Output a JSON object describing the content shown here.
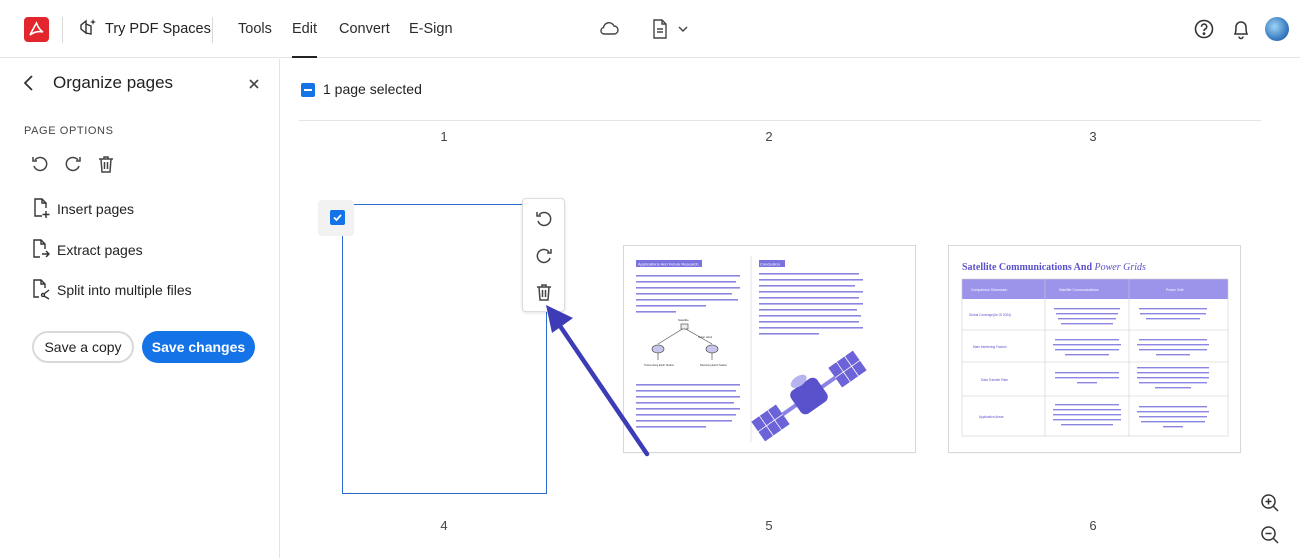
{
  "topbar": {
    "spaces_label": "Try PDF Spaces",
    "nav": [
      {
        "label": "Tools",
        "active": false
      },
      {
        "label": "Edit",
        "active": true
      },
      {
        "label": "Convert",
        "active": false
      },
      {
        "label": "E-Sign",
        "active": false
      }
    ],
    "icons": [
      "acrobat-logo-icon",
      "cloud-icon",
      "document-icon",
      "chevron-down-icon",
      "help-icon",
      "bell-icon",
      "avatar"
    ]
  },
  "sidebar": {
    "title": "Organize pages",
    "options_header": "PAGE OPTIONS",
    "items": [
      {
        "label": "Insert pages"
      },
      {
        "label": "Extract pages"
      },
      {
        "label": "Split into multiple files"
      }
    ],
    "save_copy_label": "Save a copy",
    "save_changes_label": "Save changes"
  },
  "main": {
    "selection_text": "1 page selected",
    "page_numbers": [
      "1",
      "2",
      "3",
      "4",
      "5",
      "6"
    ],
    "page5": {
      "heading_left": "Applications And Future Research",
      "heading_right": "Conclusion",
      "diagram_labels": [
        "Satellite",
        "Solar wind",
        "Transmitting Earth Station",
        "Receiving Earth Station"
      ]
    },
    "page6": {
      "title_plain": "Satellite Communications And ",
      "title_italic": "Power Grids",
      "table_headers": [
        "Comparison Dimension",
        "Satellite Communications",
        "Power Grid"
      ],
      "row_labels": [
        "Global Coverage(As Of 2024)",
        "Main Interfering Factors",
        "Data Transfer Rate",
        "Application Areas"
      ]
    }
  },
  "colors": {
    "accent": "#1473e6",
    "brand": "#e3262d",
    "arrow": "#3d3bb5",
    "thumb_purple": "#6c63d9"
  }
}
